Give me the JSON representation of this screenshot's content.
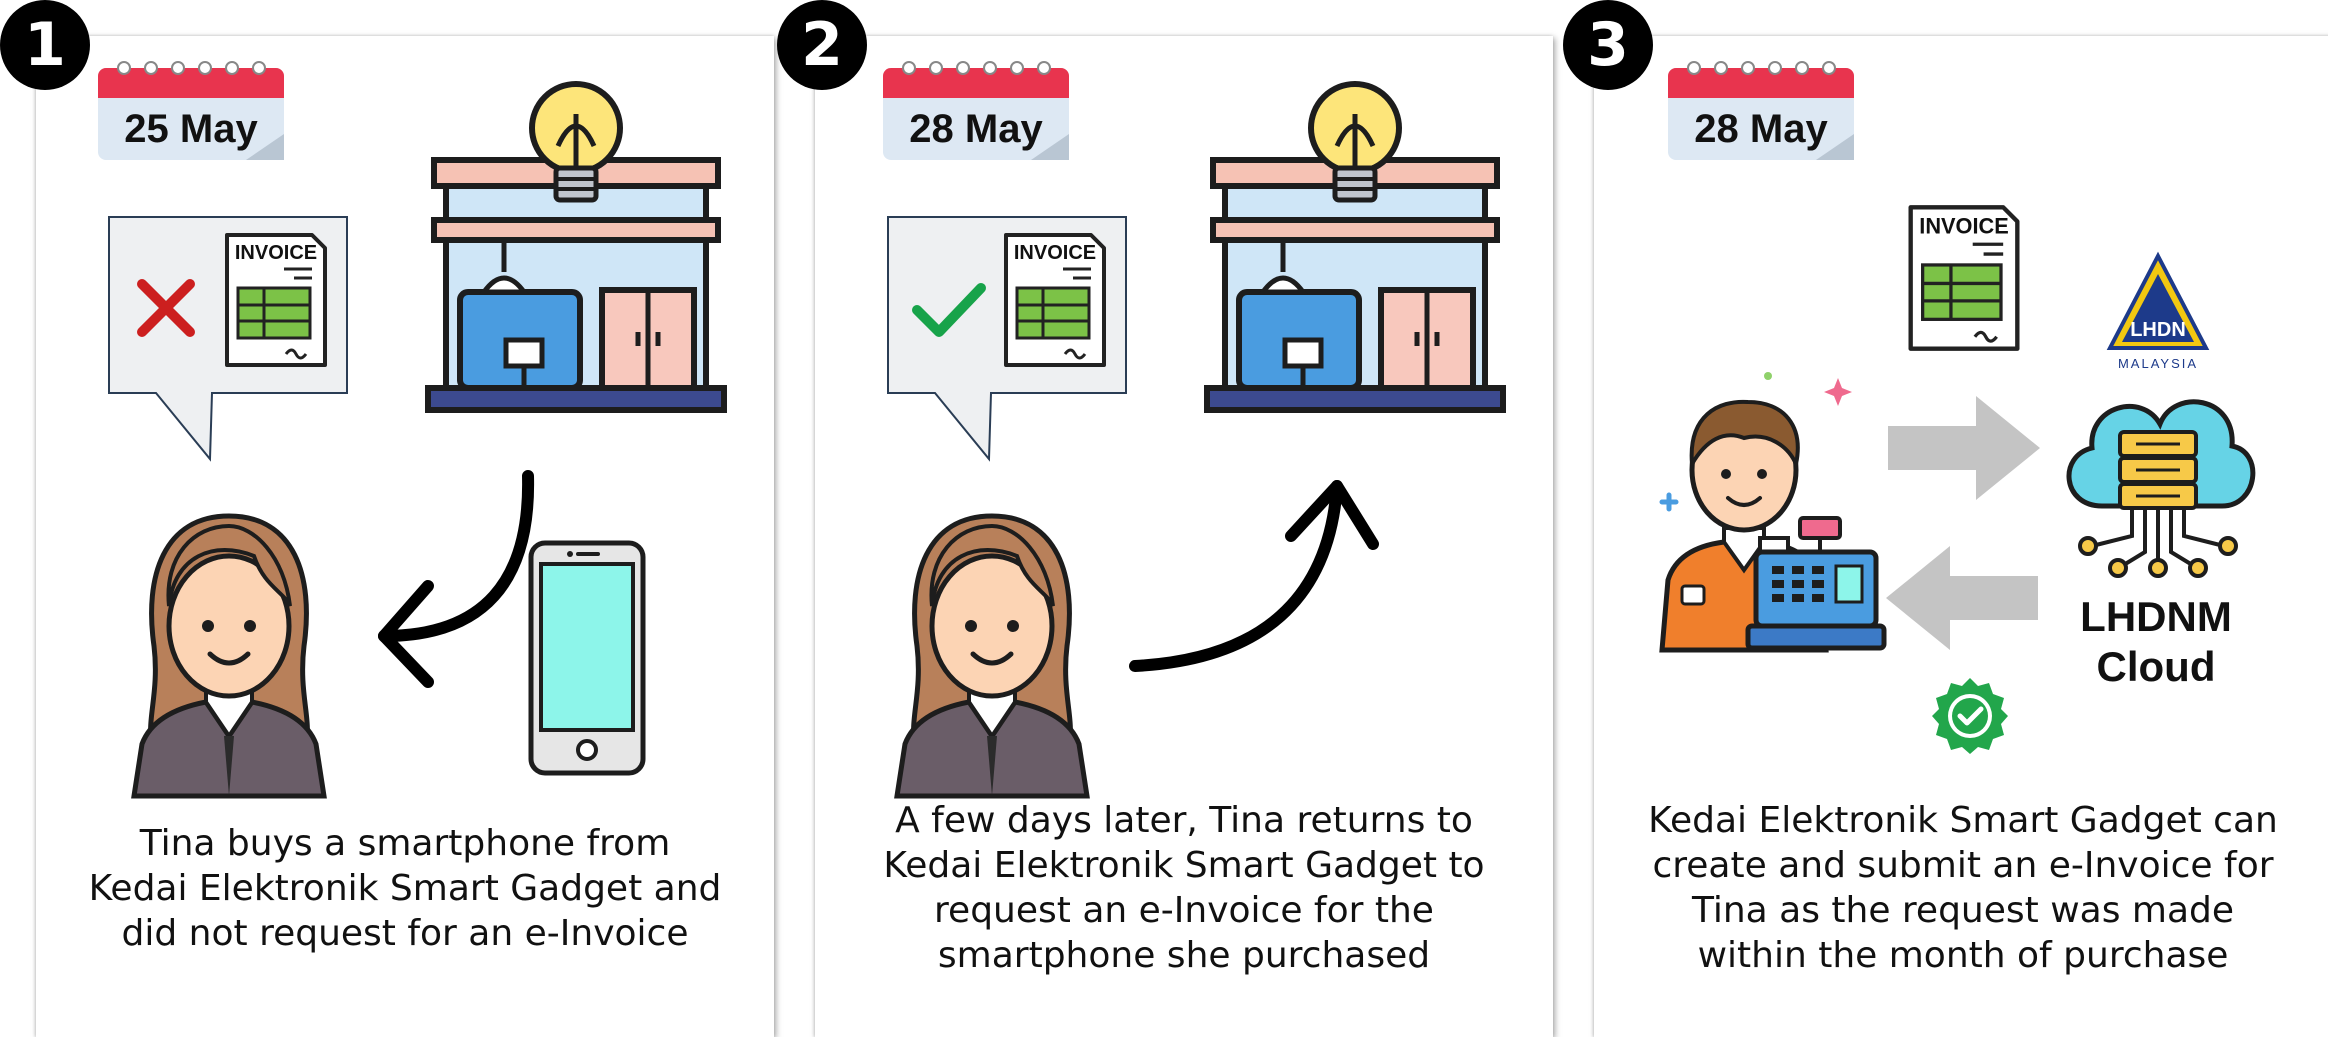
{
  "steps": [
    {
      "number": "1",
      "date": "25 May",
      "caption_lines": [
        "Tina buys a smartphone from",
        "Kedai Elektronik Smart Gadget and",
        "did not request for an e-Invoice"
      ],
      "invoice_label": "INVOICE",
      "invoice_status": "rejected"
    },
    {
      "number": "2",
      "date": "28 May",
      "caption_lines": [
        "A few days later, Tina returns to",
        "Kedai Elektronik Smart Gadget to",
        "request an e-Invoice for the",
        "smartphone she purchased"
      ],
      "invoice_label": "INVOICE",
      "invoice_status": "requested"
    },
    {
      "number": "3",
      "date": "28 May",
      "caption_lines": [
        "Kedai Elektronik Smart Gadget can",
        "create and submit an e-Invoice for",
        "Tina as the request was made",
        "within the month of purchase"
      ],
      "invoice_label": "INVOICE",
      "logo_text": "LHDN",
      "logo_subtext": "MALAYSIA",
      "cloud_label_lines": [
        "LHDNM",
        "Cloud"
      ]
    }
  ],
  "colors": {
    "calendar_red": "#e8344e",
    "cross_red": "#cc1f1f",
    "check_green": "#17a34a",
    "invoice_green": "#7cc247",
    "phone_screen": "#8df5ea",
    "shop_blue": "#4a9ce0",
    "bulb_yellow": "#fde57a",
    "arrow_gray": "#c4c4c4"
  }
}
